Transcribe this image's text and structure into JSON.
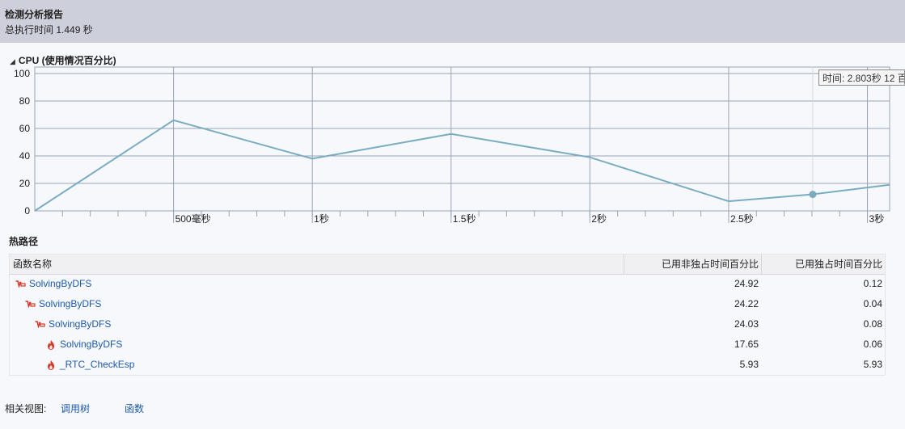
{
  "header": {
    "title": "检测分析报告",
    "subtitle": "总执行时间 1.449 秒"
  },
  "cpu_section": {
    "title": "CPU (使用情况百分比)",
    "collapse_glyph": "◢"
  },
  "tooltip": "时间: 2.803秒 12 百",
  "chart_data": {
    "type": "line",
    "title": "CPU (使用情况百分比)",
    "y_ticks": [
      "100",
      "80",
      "60",
      "40",
      "20",
      "0"
    ],
    "x_ticks": [
      "500毫秒",
      "1秒",
      "1.5秒",
      "2秒",
      "2.5秒",
      "3秒"
    ],
    "x_tick_values": [
      0.5,
      1.0,
      1.5,
      2.0,
      2.5,
      3.0
    ],
    "xlim": [
      0,
      3.08
    ],
    "ylim": [
      0,
      100
    ],
    "grid": true,
    "series": [
      {
        "x": [
          0,
          0.5,
          1.0,
          1.5,
          2.0,
          2.5,
          2.8,
          3.08
        ],
        "y": [
          0,
          66,
          38,
          56,
          39,
          7,
          12,
          19
        ]
      }
    ],
    "marker": {
      "x": 2.803,
      "y": 12
    },
    "line_color": "#7aacc0"
  },
  "hot_path": {
    "title": "热路径",
    "columns": [
      "函数名称",
      "已用非独占时间百分比",
      "已用独占时间百分比"
    ],
    "rows": [
      {
        "name": "SolvingByDFS",
        "inclusive": "24.92",
        "exclusive": "0.12",
        "icon": "hot-path-arrow-icon"
      },
      {
        "name": "SolvingByDFS",
        "inclusive": "24.22",
        "exclusive": "0.04",
        "icon": "hot-path-arrow-icon"
      },
      {
        "name": "SolvingByDFS",
        "inclusive": "24.03",
        "exclusive": "0.08",
        "icon": "hot-path-arrow-icon"
      },
      {
        "name": "SolvingByDFS",
        "inclusive": "17.65",
        "exclusive": "0.06",
        "icon": "flame-icon"
      },
      {
        "name": "_RTC_CheckEsp",
        "inclusive": "5.93",
        "exclusive": "5.93",
        "icon": "flame-icon"
      }
    ]
  },
  "footer": {
    "label": "相关视图:",
    "links": [
      "调用树",
      "函数"
    ]
  }
}
